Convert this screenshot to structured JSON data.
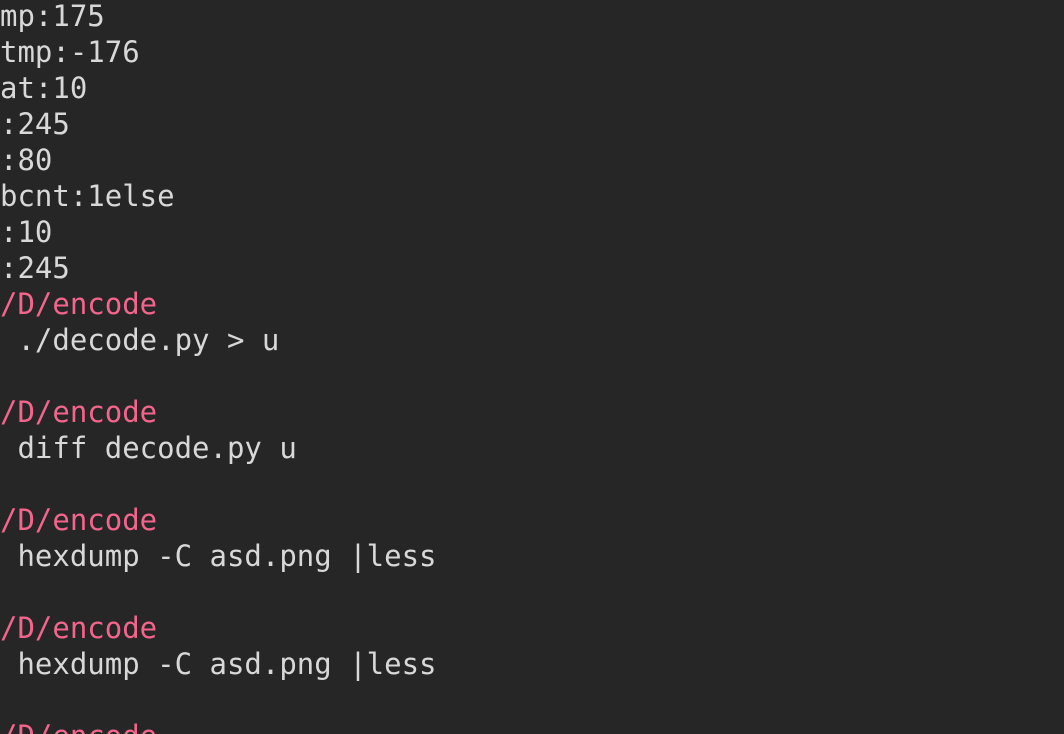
{
  "terminal": {
    "background": "#262626",
    "text_color": "#d8d8d8",
    "path_color": "#f4658c",
    "lines": [
      "mp:175",
      "tmp:-176",
      "at:10",
      ":245",
      ":80",
      "bcnt:1else",
      ":10",
      ":245",
      "/D/encode",
      " ./decode.py > u",
      "",
      "/D/encode",
      " diff decode.py u",
      "",
      "/D/encode",
      " hexdump -C asd.png |less",
      "",
      "/D/encode",
      " hexdump -C asd.png |less",
      "",
      "/D/encode"
    ]
  }
}
